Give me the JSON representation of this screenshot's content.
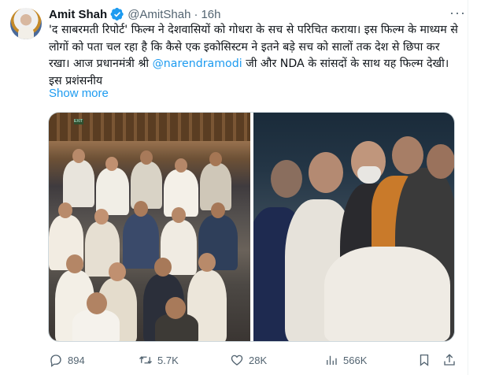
{
  "author": {
    "name": "Amit Shah",
    "handle": "@AmitShah",
    "separator": "·",
    "time": "16h"
  },
  "tweet": {
    "text_before_mention": "'द साबरमती रिपोर्ट' फिल्म ने देशवासियों को गोधरा के सच से परिचित कराया। इस फिल्म के माध्यम से लोगों को पता चल रहा है कि कैसे एक इकोसिस्टम ने इतने बड़े सच को सालों तक देश से छिपा कर रखा। आज प्रधानमंत्री श्री ",
    "mention": "@narendramodi",
    "text_after_mention": " जी और NDA के सांसदों के साथ यह फिल्म देखी। इस प्रशंसनीय",
    "show_more": "Show more"
  },
  "media": {
    "left_photo": "auditorium-audience-photo",
    "right_photo": "leaders-watching-film-photo",
    "exit_sign": "EXIT"
  },
  "actions": {
    "replies": "894",
    "retweets": "5.7K",
    "likes": "28K",
    "views": "566K"
  },
  "icons": {
    "more": "more-icon",
    "verified": "verified-badge-icon",
    "reply": "reply-icon",
    "retweet": "retweet-icon",
    "like": "heart-icon",
    "views": "views-icon",
    "bookmark": "bookmark-icon",
    "share": "share-icon"
  },
  "colors": {
    "accent": "#1d9bf0",
    "text": "#0f1419",
    "muted": "#536471",
    "verified": "#1d9bf0"
  }
}
